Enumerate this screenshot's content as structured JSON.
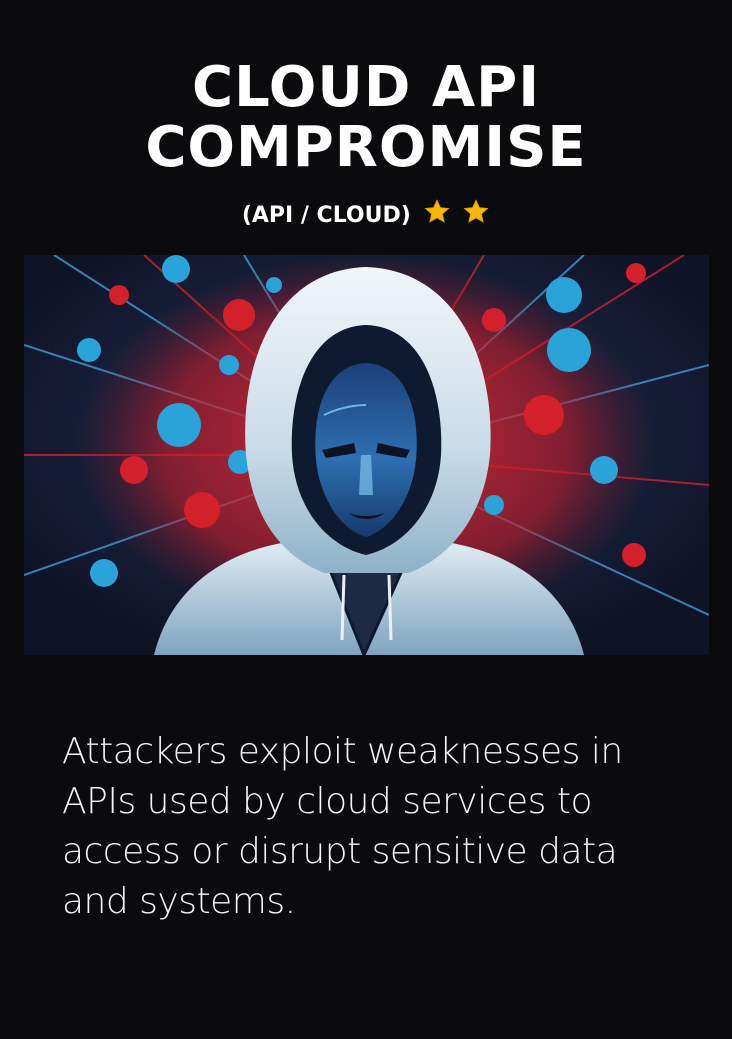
{
  "card": {
    "title_line1": "CLOUD API",
    "title_line2": "COMPROMISE",
    "subtitle": "(API / CLOUD)",
    "rating_stars": 2,
    "image_icon": "hooded-hacker-illustration",
    "description": "Attackers exploit weaknesses in APIs used by cloud services to access or disrupt sensitive data and systems."
  },
  "colors": {
    "background": "#0b0b0e",
    "accent_red": "#d4202a",
    "accent_blue": "#2aa3d8",
    "star": "#f5b800"
  }
}
